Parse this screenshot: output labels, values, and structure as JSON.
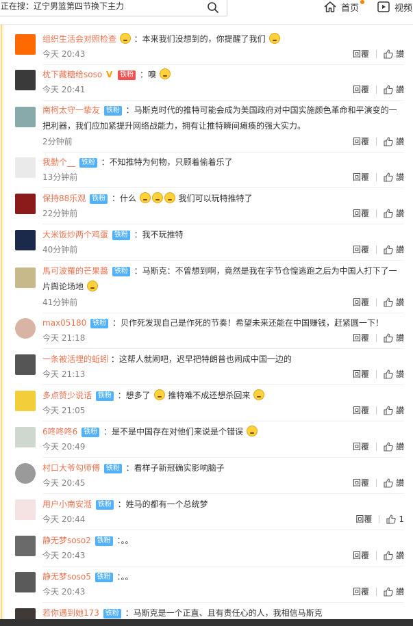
{
  "topbar": {
    "search_text": "正在搜：辽宁男篮第四节换下主力",
    "home_label": "首页",
    "video_label": "视频"
  },
  "reply_label": "回覆",
  "like_label": "讃",
  "tag_label": "铁粉",
  "comments": [
    {
      "user": "组织生活会对照检查",
      "text": "：本来我们没想到的，你提醒了我们",
      "time": "今天 20:43",
      "likes": ""
    },
    {
      "user": "枕下藏糖给soso",
      "text": "：嗅",
      "time": "今天 20:41",
      "likes": ""
    },
    {
      "user": "南柯太守一挚友",
      "text": "：马斯克时代的推特可能会成为美国政府对中国实施颜色革命和平演变的一把利器，我们应加紧提升网络战能力，拥有让推特瞬间瘫痪的强大实力。",
      "time": "2分钟前",
      "likes": ""
    },
    {
      "user": "我勤个__",
      "text": "：不知推特为何物，只顾着偷着乐了",
      "time": "13分钟前",
      "likes": ""
    },
    {
      "user": "保持88乐观",
      "text": "：什么",
      "text2": "我们可以玩特推特了",
      "time": "22分钟前",
      "likes": ""
    },
    {
      "user": "大米饭炒两个鸡蛋",
      "text": "：我不玩推特",
      "time": "40分钟前",
      "likes": ""
    },
    {
      "user": "馬可波羅的芒果醬",
      "text": "：马斯克：不曾想到啊，竟然是我在字节仓惶逃跑之后为中国人打下了一片舆论场地",
      "time": "41分钟前",
      "likes": ""
    },
    {
      "user": "max05180",
      "text": "：贝作死发现自己是作死的节奏！希望未来还能在中国赚钱，赶紧圆一下！",
      "time": "今天 21:18",
      "likes": ""
    },
    {
      "user": "一条被活埋的蚯蚓",
      "text": "：这帮人就闹吧，迟早把特朗普也闹成中国一边的",
      "time": "今天 21:13",
      "likes": ""
    },
    {
      "user": "多点赞少说话",
      "text": "：想多了",
      "text2": "推特难不成还想杀回来",
      "time": "今天 21:05",
      "likes": ""
    },
    {
      "user": "6咚咚咚6",
      "text": "：是不是中国存在对他们来说是个错误",
      "time": "今天 20:49",
      "likes": ""
    },
    {
      "user": "村口大爷勾师傅",
      "text": "：看样子新冠确实影响脑子",
      "time": "今天 20:45",
      "likes": ""
    },
    {
      "user": "用户小南安湉",
      "text": "：姓马的都有一个总统梦",
      "time": "今天 20:44",
      "likes": "1"
    },
    {
      "user": "静无梦soso2",
      "text": "：。。",
      "time": "今天 20:43",
      "likes": ""
    },
    {
      "user": "静无梦soso5",
      "text": "：。。",
      "time": "今天 20:43",
      "likes": ""
    },
    {
      "user": "若你遇到她173",
      "text": "：马斯克是一个正直、且有责任心的人，我相信马斯克",
      "time": "",
      "likes": ""
    }
  ]
}
